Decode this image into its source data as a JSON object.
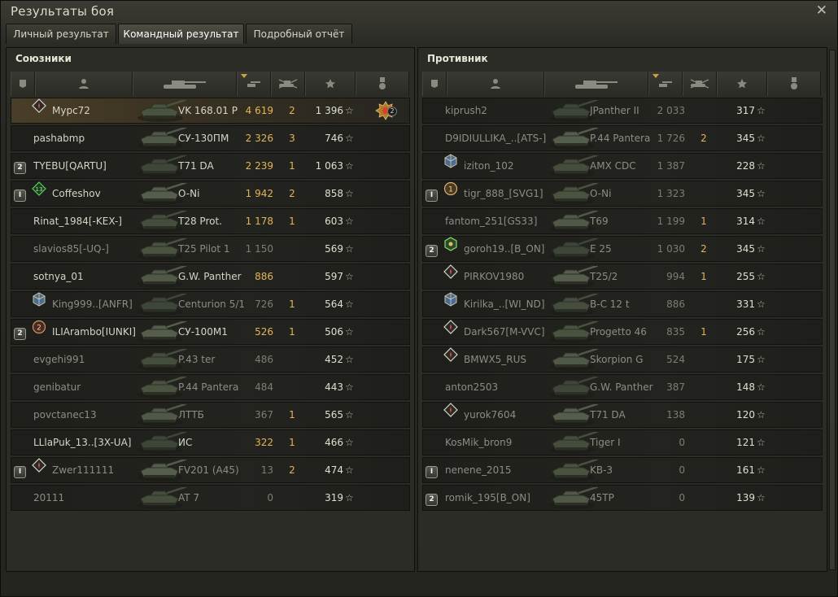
{
  "window": {
    "title": "Результаты боя"
  },
  "tabs": [
    "Личный результат",
    "Командный результат",
    "Подробный отчёт"
  ],
  "active_tab": 1,
  "left": {
    "title": "Союзники",
    "rows": [
      {
        "badge": "",
        "icon": "diamond",
        "name": "Мурс72",
        "tank": "VK 168.01 P",
        "damage": "4 619",
        "kills": "2",
        "xp": "1 396",
        "medal": "2",
        "me": true,
        "dim": false
      },
      {
        "badge": "",
        "icon": "",
        "name": "pashabmp",
        "tank": "СУ-130ПМ",
        "damage": "2 326",
        "kills": "3",
        "xp": "746",
        "medal": "",
        "me": false,
        "dim": false
      },
      {
        "badge": "2",
        "icon": "",
        "name": "TYEBU[QARTU]",
        "tank": "T71 DA",
        "damage": "2 239",
        "kills": "1",
        "xp": "1 063",
        "medal": "",
        "me": false,
        "dim": false
      },
      {
        "badge": "I",
        "icon": "green13",
        "name": "Coffeshov",
        "tank": "O-Ni",
        "damage": "1 942",
        "kills": "2",
        "xp": "858",
        "medal": "",
        "me": false,
        "dim": false
      },
      {
        "badge": "",
        "icon": "",
        "name": "Rinat_1984[-KEX-]",
        "tank": "T28 Prot.",
        "damage": "1 178",
        "kills": "1",
        "xp": "603",
        "medal": "",
        "me": false,
        "dim": false
      },
      {
        "badge": "",
        "icon": "",
        "name": "slavios85[-UQ-]",
        "tank": "T25 Pilot 1",
        "damage": "1 150",
        "kills": "",
        "xp": "569",
        "medal": "",
        "me": false,
        "dim": true
      },
      {
        "badge": "",
        "icon": "",
        "name": "sotnya_01",
        "tank": "G.W. Panther",
        "damage": "886",
        "kills": "",
        "xp": "597",
        "medal": "",
        "me": false,
        "dim": false
      },
      {
        "badge": "",
        "icon": "cube",
        "name": "King999..[ANFR]",
        "tank": "Centurion 5/1",
        "damage": "726",
        "kills": "1",
        "xp": "564",
        "medal": "",
        "me": false,
        "dim": true
      },
      {
        "badge": "2",
        "icon": "round2",
        "name": "ILIArambo[IUNKI]",
        "tank": "СУ-100М1",
        "damage": "526",
        "kills": "1",
        "xp": "506",
        "medal": "",
        "me": false,
        "dim": false
      },
      {
        "badge": "",
        "icon": "",
        "name": "evgehi991",
        "tank": "P.43 ter",
        "damage": "486",
        "kills": "",
        "xp": "452",
        "medal": "",
        "me": false,
        "dim": true
      },
      {
        "badge": "",
        "icon": "",
        "name": "genibatur",
        "tank": "P.44 Pantera",
        "damage": "484",
        "kills": "",
        "xp": "443",
        "medal": "",
        "me": false,
        "dim": true
      },
      {
        "badge": "",
        "icon": "",
        "name": "povctanec13",
        "tank": "ЛТТБ",
        "damage": "367",
        "kills": "1",
        "xp": "565",
        "medal": "",
        "me": false,
        "dim": true
      },
      {
        "badge": "",
        "icon": "",
        "name": "LLlaPuk_13..[3X-UA]",
        "tank": "ИС",
        "damage": "322",
        "kills": "1",
        "xp": "466",
        "medal": "",
        "me": false,
        "dim": false
      },
      {
        "badge": "I",
        "icon": "diamond",
        "name": "Zwer111111",
        "tank": "FV201 (A45)",
        "damage": "13",
        "kills": "2",
        "xp": "474",
        "medal": "",
        "me": false,
        "dim": true
      },
      {
        "badge": "",
        "icon": "",
        "name": "20111",
        "tank": "AT 7",
        "damage": "0",
        "kills": "",
        "xp": "319",
        "medal": "",
        "me": false,
        "dim": true
      }
    ]
  },
  "right": {
    "title": "Противник",
    "rows": [
      {
        "badge": "",
        "icon": "",
        "name": "kiprush2",
        "tank": "JPanther II",
        "damage": "2 033",
        "kills": "",
        "xp": "317",
        "dim": true
      },
      {
        "badge": "",
        "icon": "",
        "name": "D9IDIULLIKA_..[ATS-]",
        "tank": "P.44 Pantera",
        "damage": "1 726",
        "kills": "2",
        "xp": "345",
        "dim": true
      },
      {
        "badge": "",
        "icon": "cube",
        "name": "iziton_102",
        "tank": "AMX CDC",
        "damage": "1 387",
        "kills": "",
        "xp": "228",
        "dim": true
      },
      {
        "badge": "I",
        "icon": "round1",
        "name": "tigr_888_[SVG1]",
        "tank": "O-Ni",
        "damage": "1 323",
        "kills": "",
        "xp": "345",
        "dim": true
      },
      {
        "badge": "",
        "icon": "",
        "name": "fantom_251[GS33]",
        "tank": "T69",
        "damage": "1 199",
        "kills": "1",
        "xp": "314",
        "dim": true
      },
      {
        "badge": "2",
        "icon": "greenhex",
        "name": "goroh19..[B_ON]",
        "tank": "E 25",
        "damage": "1 030",
        "kills": "2",
        "xp": "345",
        "dim": true
      },
      {
        "badge": "",
        "icon": "diamond",
        "name": "PIRKOV1980",
        "tank": "T25/2",
        "damage": "994",
        "kills": "1",
        "xp": "255",
        "dim": true
      },
      {
        "badge": "",
        "icon": "cube",
        "name": "Kirilka_..[WI_ND]",
        "tank": "B-C 12 t",
        "damage": "886",
        "kills": "",
        "xp": "331",
        "dim": true
      },
      {
        "badge": "",
        "icon": "diamond",
        "name": "Dark567[M-VVC]",
        "tank": "Progetto 46",
        "damage": "835",
        "kills": "1",
        "xp": "256",
        "dim": true
      },
      {
        "badge": "",
        "icon": "diamond",
        "name": "BMWX5_RUS",
        "tank": "Skorpion G",
        "damage": "524",
        "kills": "",
        "xp": "175",
        "dim": true
      },
      {
        "badge": "",
        "icon": "",
        "name": "anton2503",
        "tank": "G.W. Panther",
        "damage": "387",
        "kills": "",
        "xp": "148",
        "dim": true
      },
      {
        "badge": "",
        "icon": "diamond",
        "name": "yurok7604",
        "tank": "T71 DA",
        "damage": "138",
        "kills": "",
        "xp": "120",
        "dim": true
      },
      {
        "badge": "",
        "icon": "",
        "name": "KosMik_bron9",
        "tank": "Tiger I",
        "damage": "0",
        "kills": "",
        "xp": "121",
        "dim": true
      },
      {
        "badge": "I",
        "icon": "",
        "name": "nenene_2015",
        "tank": "KB-3",
        "damage": "0",
        "kills": "",
        "xp": "161",
        "dim": true
      },
      {
        "badge": "2",
        "icon": "",
        "name": "romik_195[B_ON]",
        "tank": "45TP",
        "damage": "0",
        "kills": "",
        "xp": "139",
        "dim": true
      }
    ]
  },
  "icons": {
    "close": "close-icon",
    "columns": [
      "rank-icon",
      "player-icon",
      "tank-icon",
      "damage-icon",
      "kills-icon",
      "xp-star-icon",
      "medal-icon"
    ],
    "star": "☆"
  },
  "colors": {
    "accent": "#e3b55a",
    "me_row": "#4a3e28",
    "dim_text": "#8f8d82"
  }
}
